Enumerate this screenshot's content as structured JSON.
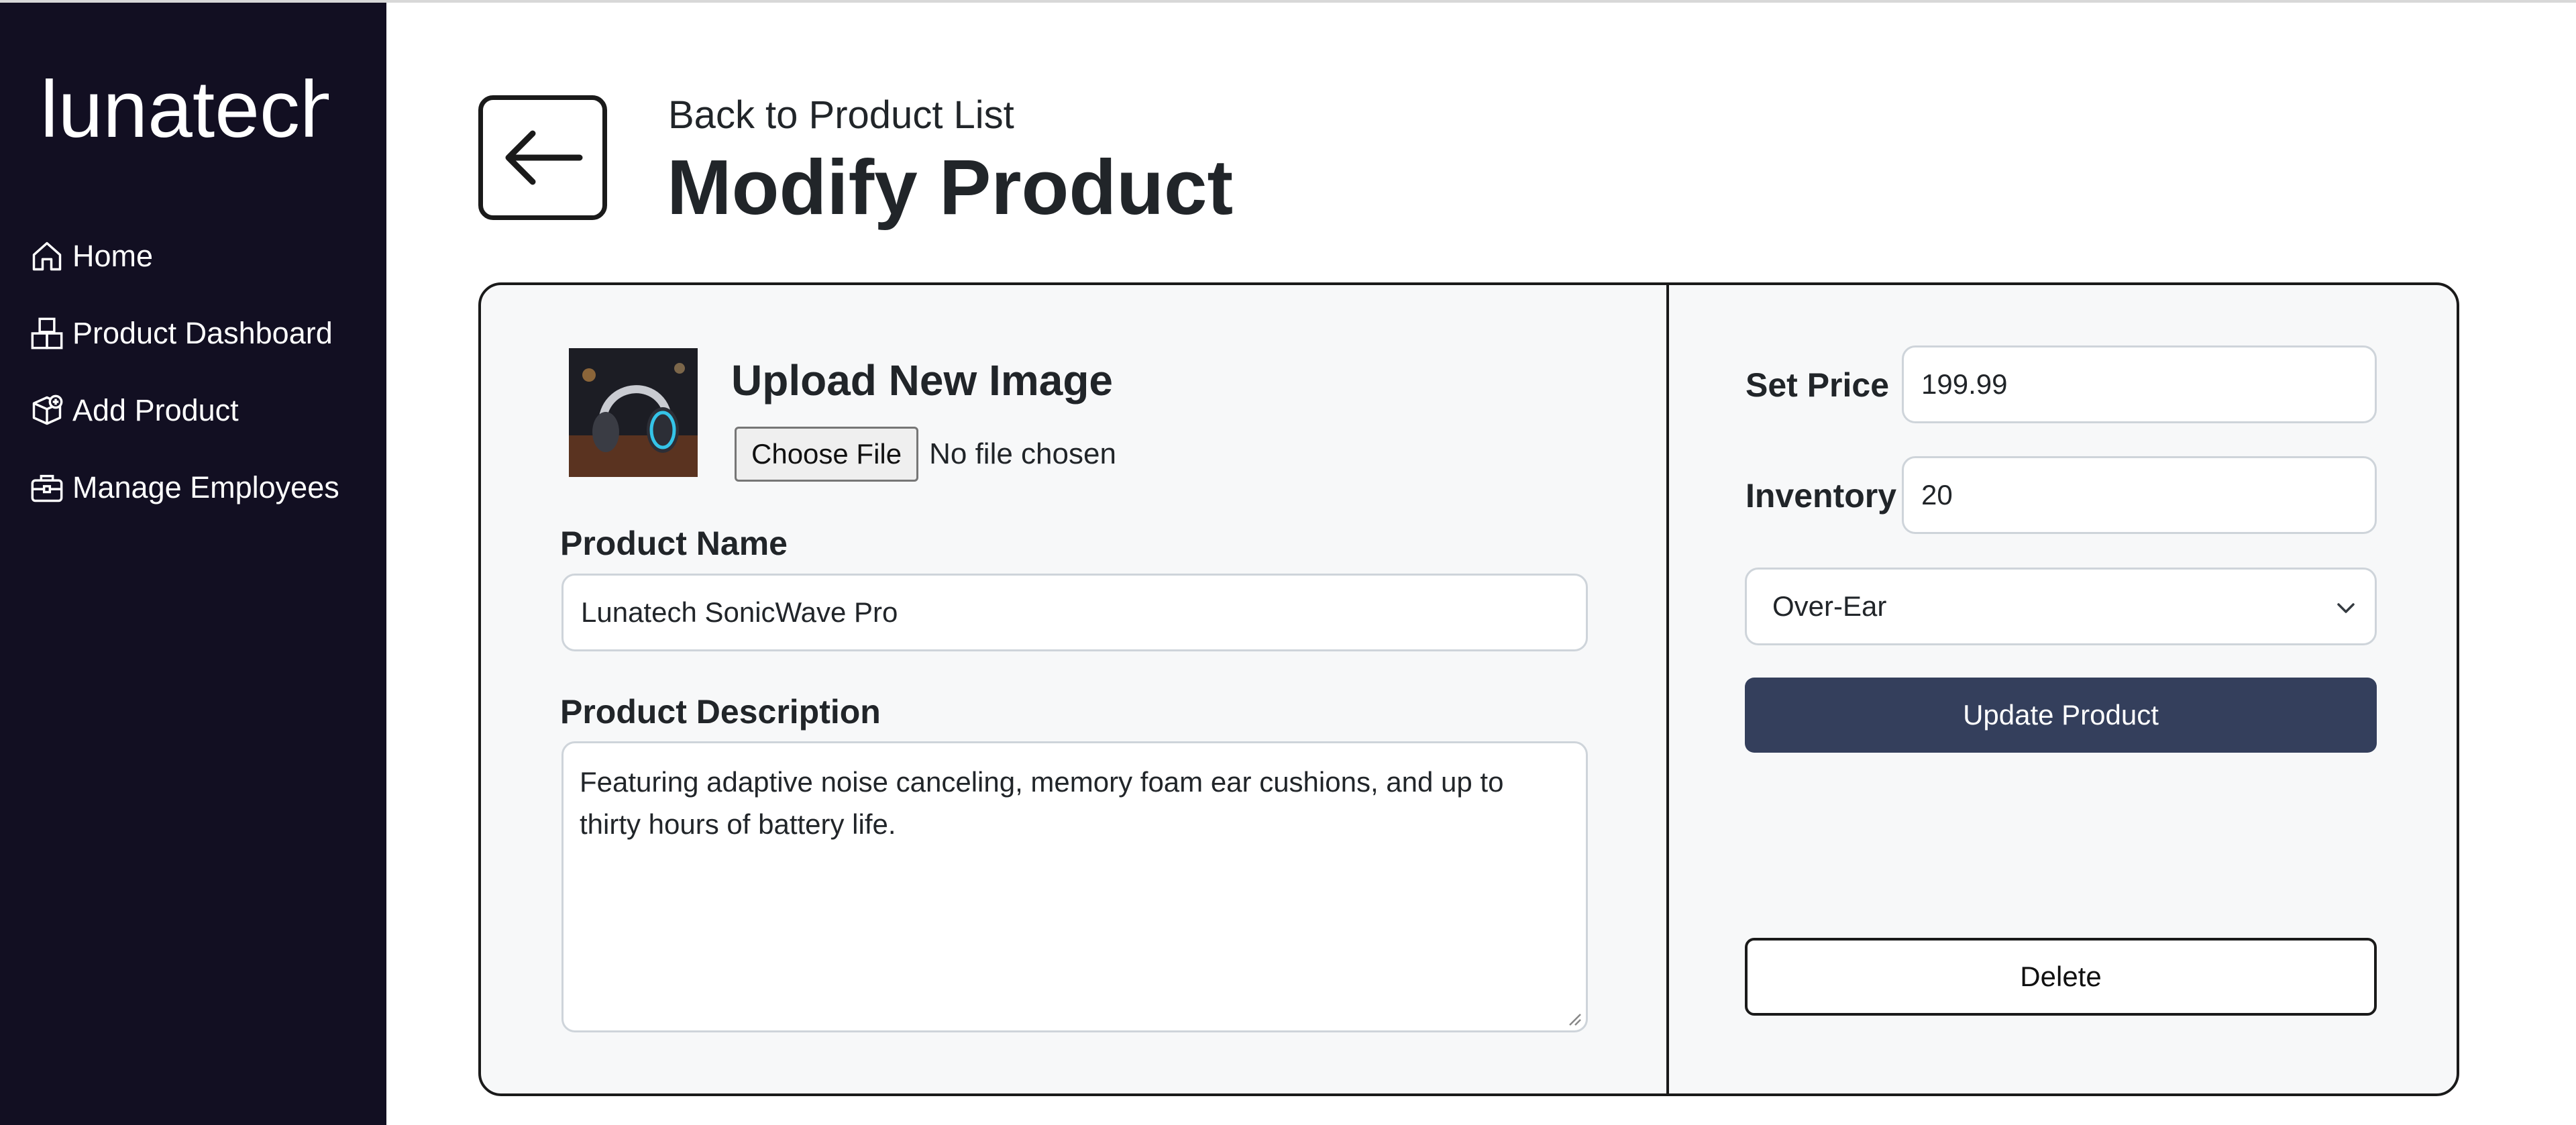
{
  "brand": {
    "logo_text": "lunatech"
  },
  "sidebar": {
    "items": [
      {
        "label": "Home",
        "icon": "home-icon"
      },
      {
        "label": "Product Dashboard",
        "icon": "boxes-icon"
      },
      {
        "label": "Add Product",
        "icon": "box-add-icon"
      },
      {
        "label": "Manage Employees",
        "icon": "briefcase-icon"
      }
    ]
  },
  "header": {
    "back_link": "Back to Product List",
    "title": "Modify Product",
    "back_icon": "arrow-left-icon"
  },
  "form": {
    "upload_title": "Upload New Image",
    "choose_file_label": "Choose File",
    "no_file_text": "No file chosen",
    "name_label": "Product Name",
    "name_value": "Lunatech SonicWave Pro",
    "description_label": "Product Description",
    "description_value": "Featuring adaptive noise canceling, memory foam ear cushions, and up to thirty hours of battery life.",
    "price_label": "Set Price",
    "price_value": "199.99",
    "inventory_label": "Inventory",
    "inventory_value": "20",
    "category_selected": "Over-Ear",
    "update_button": "Update Product",
    "delete_button": "Delete"
  },
  "colors": {
    "sidebar_bg": "#120f22",
    "card_bg": "#f7f8f9",
    "primary_button": "#343f5c",
    "text": "#212529"
  }
}
